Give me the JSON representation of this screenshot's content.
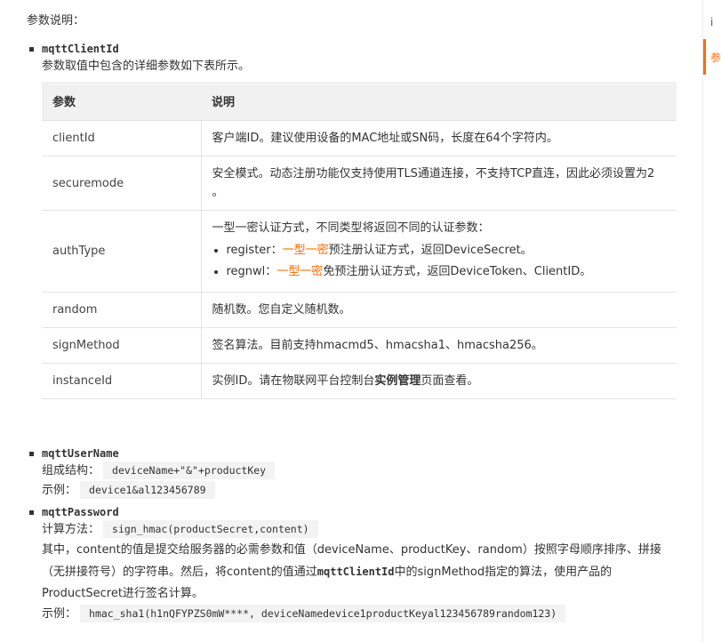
{
  "intro": "参数说明：",
  "client_id": {
    "name": "mqttClientId",
    "desc": "参数取值中包含的详细参数如下表所示。",
    "table": {
      "headers": [
        "参数",
        "说明"
      ],
      "rows": [
        {
          "param": "clientId",
          "desc": "客户端ID。建议使用设备的MAC地址或SN码，长度在64个字符内。"
        },
        {
          "param": "securemode",
          "desc": "安全模式。动态注册功能仅支持使用TLS通道连接，不支持TCP直连，因此必须设置为2 。"
        },
        {
          "param": "authType",
          "desc": "一型一密认证方式，不同类型将返回不同的认证参数：",
          "items": [
            {
              "prefix": "register：",
              "link": "一型一密",
              "suffix": "预注册认证方式，返回DeviceSecret。"
            },
            {
              "prefix": "regnwl：",
              "link": "一型一密",
              "suffix": "免预注册认证方式，返回DeviceToken、ClientID。"
            }
          ]
        },
        {
          "param": "random",
          "desc": "随机数。您自定义随机数。"
        },
        {
          "param": "signMethod",
          "desc": "签名算法。目前支持hmacmd5、hmacsha1、hmacsha256。"
        },
        {
          "param": "instanceId",
          "desc_pre": "实例ID。请在物联网平台控制台",
          "desc_bold": "实例管理",
          "desc_post": "页面查看。"
        }
      ]
    }
  },
  "username": {
    "name": "mqttUserName",
    "struct_label": "组成结构：",
    "struct_code": "deviceName+\"&\"+productKey",
    "example_label": "示例：",
    "example_code": "device1&al123456789"
  },
  "password": {
    "name": "mqttPassword",
    "calc_label": "计算方法：",
    "calc_code": "sign_hmac(productSecret,content)",
    "desc_pre": "其中，content的值是提交给服务器的必需参数和值（deviceName、productKey、random）按照字母顺序排序、拼接（无拼接符号）的字符串。然后，将content的值通过",
    "desc_code": "mqttClientId",
    "desc_post": "中的signMethod指定的算法，使用产品的ProductSecret进行签名计算。",
    "example_label": "示例：",
    "example_code": "hmac_sha1(h1nQFYPZS0mW****, deviceNamedevice1productKeyal123456789random123)"
  },
  "sidebar": {
    "char1": "i",
    "char2": "参"
  },
  "colors": {
    "accent": "#ff6a00"
  }
}
